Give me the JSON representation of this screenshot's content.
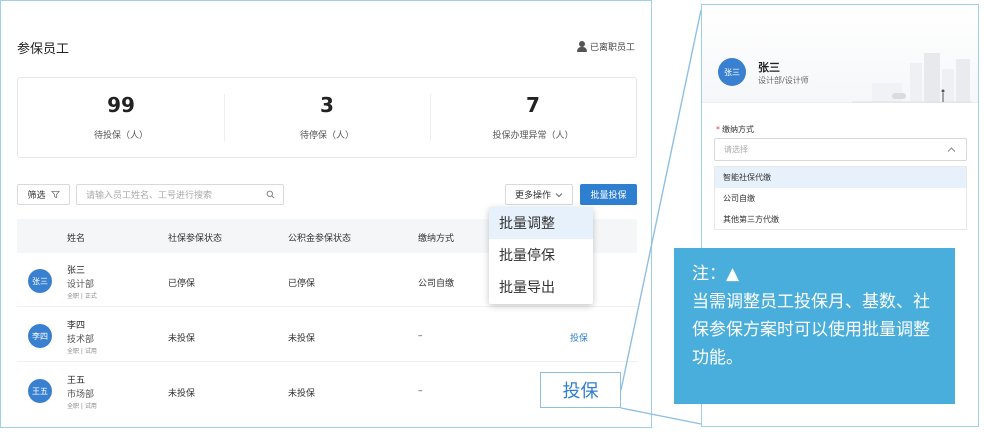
{
  "main": {
    "title": "参保员工",
    "resigned_link": "已离职员工",
    "stats": [
      {
        "value": "99",
        "label": "待投保（人）"
      },
      {
        "value": "3",
        "label": "待停保（人）"
      },
      {
        "value": "7",
        "label": "投保办理异常（人）"
      }
    ],
    "toolbar": {
      "filter_label": "筛选",
      "search_placeholder": "请输入员工姓名、工号进行搜索",
      "more_ops_label": "更多操作",
      "batch_insure_label": "批量投保"
    },
    "table": {
      "headers": [
        "姓名",
        "社保参保状态",
        "公积金参保状态",
        "缴纳方式"
      ],
      "rows": [
        {
          "avatar": "张三",
          "name": "张三",
          "dept": "设计部",
          "tag": "全职 | 正式",
          "social": "已停保",
          "fund": "已停保",
          "method": "公司自缴",
          "action": ""
        },
        {
          "avatar": "李四",
          "name": "李四",
          "dept": "技术部",
          "tag": "全职 | 试用",
          "social": "未投保",
          "fund": "未投保",
          "method": "–",
          "action": "投保"
        },
        {
          "avatar": "王五",
          "name": "王五",
          "dept": "市场部",
          "tag": "全职 | 试用",
          "social": "未投保",
          "fund": "未投保",
          "method": "–",
          "action": ""
        }
      ]
    },
    "dropdown": [
      "批量调整",
      "批量停保",
      "批量导出"
    ],
    "callout_insure": "投保"
  },
  "side": {
    "avatar": "张三",
    "name": "张三",
    "dept": "设计部/设计师",
    "field_label": "缴纳方式",
    "select_placeholder": "请选择",
    "options": [
      "智能社保代缴",
      "公司自缴",
      "其他第三方代缴"
    ]
  },
  "note": {
    "title": "注：▲",
    "body": "当需调整员工投保月、基数、社保参保方案时可以使用批量调整功能。"
  },
  "colors": {
    "primary": "#2f7fd1",
    "avatar": "#3a80d0",
    "note_bg": "#4aaedd",
    "frame_border": "#9fd0ea",
    "required": "#e54545"
  },
  "icons": [
    "person-icon",
    "funnel-icon",
    "search-icon",
    "chevron-down-icon",
    "chevron-up-icon"
  ]
}
